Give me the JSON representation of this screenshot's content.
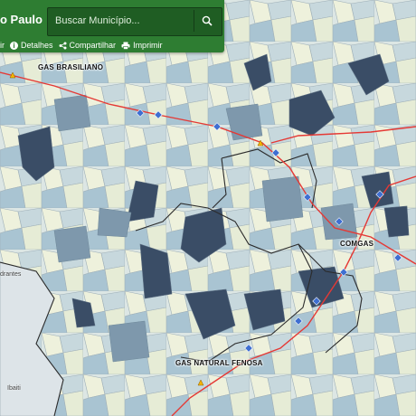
{
  "app": {
    "title": "o Paulo"
  },
  "search": {
    "placeholder": "Buscar Município..."
  },
  "toolbar": {
    "items": [
      {
        "label": "ir",
        "icon": "filter-icon"
      },
      {
        "label": "Detalhes",
        "icon": "info-icon"
      },
      {
        "label": "Compartilhar",
        "icon": "share-icon"
      },
      {
        "label": "Imprimir",
        "icon": "print-icon"
      }
    ]
  },
  "map": {
    "pipelines": [
      {
        "name": "GAS BRASILIANO"
      },
      {
        "name": "COMGAS"
      },
      {
        "name": "GAS NATURAL FENOSA"
      }
    ],
    "places": [
      "drantes",
      "Ibaiti"
    ],
    "colors": {
      "pipeline": "#e53935",
      "pipeline_marker": "#3f6fd1",
      "shade_light": "#f1f2dc",
      "shade_mid": "#a9c4d2",
      "shade_dark": "#3a4d66"
    }
  }
}
